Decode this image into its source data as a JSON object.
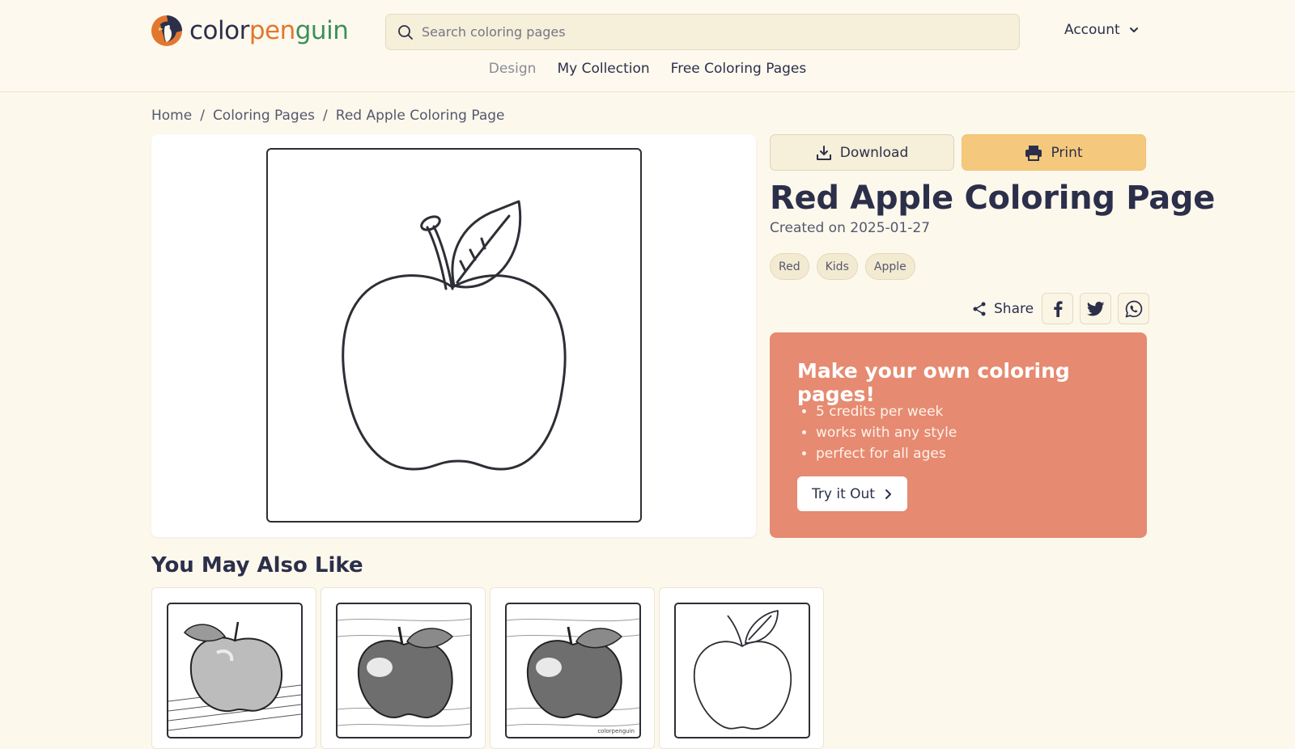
{
  "header": {
    "logo": {
      "part1": "color",
      "part2": "pen",
      "part3": "guin"
    },
    "search": {
      "placeholder": "Search coloring pages",
      "value": ""
    },
    "account_label": "Account"
  },
  "nav": {
    "items": [
      {
        "label": "Design"
      },
      {
        "label": "My Collection"
      },
      {
        "label": "Free Coloring Pages"
      }
    ]
  },
  "breadcrumb": {
    "items": [
      "Home",
      "Coloring Pages",
      "Red Apple Coloring Page"
    ],
    "separator": "/"
  },
  "actions": {
    "download_label": "Download",
    "print_label": "Print"
  },
  "page": {
    "title": "Red Apple Coloring Page",
    "created": "Created on 2025-01-27",
    "tags": [
      "Red",
      "Kids",
      "Apple"
    ]
  },
  "share": {
    "label": "Share",
    "networks": [
      "facebook-icon",
      "twitter-icon",
      "whatsapp-icon"
    ]
  },
  "promo": {
    "title": "Make your own coloring pages!",
    "bullets": [
      "5 credits per week",
      "works with any style",
      "perfect for all ages"
    ],
    "button_label": "Try it Out",
    "color": "#d9512c"
  },
  "related": {
    "title": "You May Also Like",
    "thumb_watermark": "colorpenguin"
  },
  "colors": {
    "background": "#fdf8ec",
    "text": "#2c2f4a",
    "print_button": "#f5c97d",
    "logo_orange": "#e2772e",
    "logo_green": "#3f8f5b"
  }
}
